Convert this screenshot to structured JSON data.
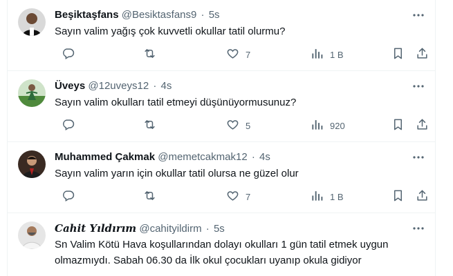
{
  "tweets": [
    {
      "name": "Beşiktaşfans",
      "handle": "@Besiktasfans9",
      "time": "5s",
      "text": "Sayın valim yağış çok kuvvetli okullar tatil olurmu?",
      "likes": "7",
      "views": "1 B"
    },
    {
      "name": "Üveys",
      "handle": "@12uveys12",
      "time": "4s",
      "text": "Sayın valim okulları tatil etmeyi düşünüyormusunuz?",
      "likes": "5",
      "views": "920"
    },
    {
      "name": "Muhammed Çakmak",
      "handle": "@memetcakmak12",
      "time": "4s",
      "text": "Sayın valim yarın için okullar tatil olursa ne güzel olur",
      "likes": "7",
      "views": "1 B"
    },
    {
      "name": "Cahit Yıldırım",
      "handle": "@cahityildirm",
      "time": "5s",
      "text": "Sn Valim Kötü Hava koşullarından dolayı okulları 1 gün tatil etmek uygun olmazmıydı. Sabah 06.30 da İlk okul çocukları uyanıp okula gidiyor"
    }
  ],
  "separator": "·",
  "icons": {
    "more": "more-horizontal-icon",
    "reply": "reply-icon",
    "retweet": "retweet-icon",
    "like": "heart-icon",
    "views": "views-chart-icon",
    "bookmark": "bookmark-icon",
    "share": "share-icon"
  },
  "colors": {
    "text": "#0f1419",
    "secondary": "#536471",
    "border": "#eff3f4"
  }
}
